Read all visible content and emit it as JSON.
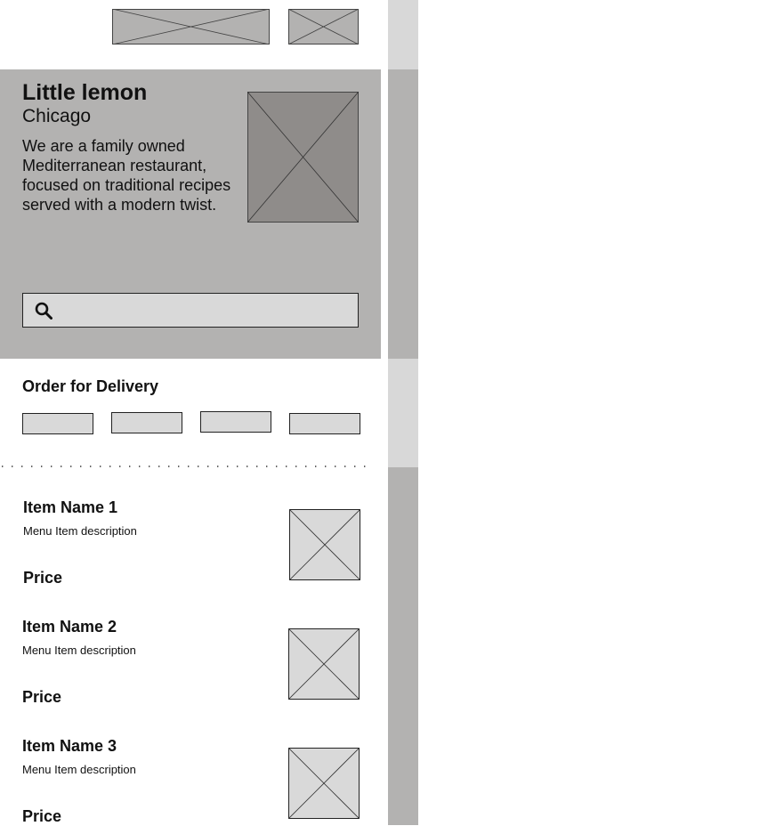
{
  "hero": {
    "title": "Little lemon",
    "city": "Chicago",
    "description": "We are a family owned Mediterranean restaurant, focused on traditional recipes served with a modern twist.",
    "search_icon": "search-icon"
  },
  "delivery": {
    "title": "Order for Delivery",
    "categories": [
      "",
      "",
      "",
      ""
    ]
  },
  "menu": {
    "items": [
      {
        "name": "Item Name 1",
        "description": "Menu Item description",
        "price": "Price"
      },
      {
        "name": "Item Name 2",
        "description": "Menu Item description",
        "price": "Price"
      },
      {
        "name": "Item Name 3",
        "description": "Menu Item description",
        "price": "Price"
      }
    ]
  },
  "colors": {
    "hero_bg": "#b3b2b1",
    "placeholder_light": "#d9d9d9",
    "placeholder_dark": "#8f8c8a",
    "sidebar_light": "#d8d8d8",
    "sidebar_dark": "#b3b2b1"
  }
}
